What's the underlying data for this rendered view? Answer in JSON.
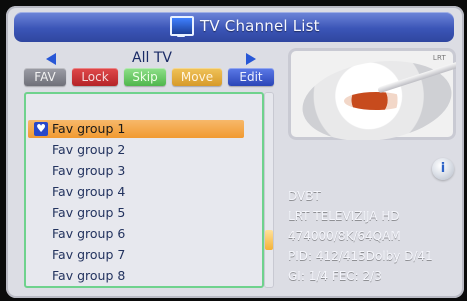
{
  "header": {
    "title": "TV Channel List",
    "icon": "tv-icon"
  },
  "left": {
    "nav": {
      "label": "All TV",
      "left_icon": "arrow-left-icon",
      "right_icon": "arrow-right-icon"
    },
    "tabs": [
      {
        "label": "FAV"
      },
      {
        "label": "Lock"
      },
      {
        "label": "Skip"
      },
      {
        "label": "Move"
      },
      {
        "label": "Edit"
      }
    ],
    "list": {
      "items": [
        "Fav group 1",
        "Fav group 2",
        "Fav group 3",
        "Fav group 4",
        "Fav group 5",
        "Fav group 6",
        "Fav group 7",
        "Fav group 8"
      ],
      "selected_index": 0,
      "selected_marker": "heart-icon"
    }
  },
  "preview": {
    "logo": "LRT"
  },
  "info": {
    "button": "i",
    "lines": [
      "DVBT",
      "LRT TELEVIZIJA HD",
      "474000/8K/64QAM",
      "PID: 412/415Dolby D/41",
      "GI: 1/4  FEC: 2/3"
    ]
  },
  "colors": {
    "header_gradient": [
      "#6f86d9",
      "#2f469f"
    ],
    "panel_bg": "#dcdde4",
    "list_border": "#6fd28d",
    "selection": "#f19a31",
    "tab_lock": "#b52327",
    "tab_skip": "#4fb64c",
    "tab_move": "#d79a29",
    "tab_edit": "#2a45b7",
    "info_text": "#f4f5fb"
  }
}
